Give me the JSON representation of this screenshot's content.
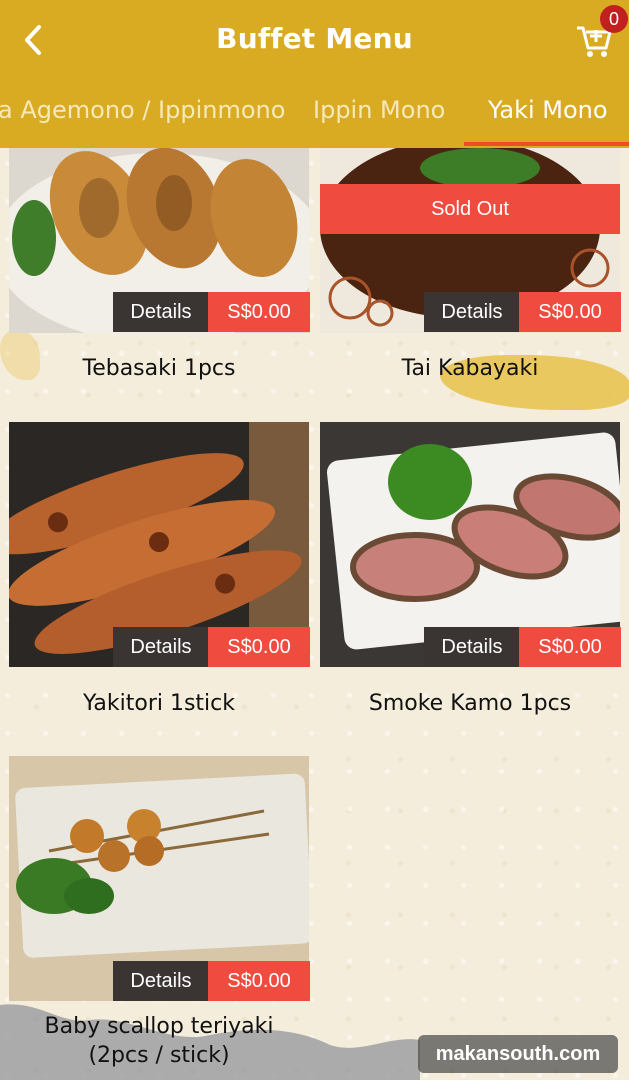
{
  "header": {
    "title": "Buffet Menu",
    "cart_count": "0"
  },
  "tabs": [
    {
      "label": "a Agemono / Ippinmono",
      "active": false
    },
    {
      "label": "Ippin Mono",
      "active": false
    },
    {
      "label": "Yaki Mono",
      "active": true
    }
  ],
  "items": [
    {
      "name": "Tebasaki 1pcs",
      "details": "Details",
      "price": "S$0.00",
      "sold_out": false
    },
    {
      "name": "Tai Kabayaki",
      "details": "Details",
      "price": "S$0.00",
      "sold_out": true,
      "sold_out_label": "Sold Out"
    },
    {
      "name": "Yakitori 1stick",
      "details": "Details",
      "price": "S$0.00",
      "sold_out": false
    },
    {
      "name": "Smoke Kamo 1pcs",
      "details": "Details",
      "price": "S$0.00",
      "sold_out": false
    },
    {
      "name": "Baby scallop teriyaki",
      "name_line2": "(2pcs / stick)",
      "details": "Details",
      "price": "S$0.00",
      "sold_out": false
    }
  ],
  "watermark": "makansouth.com",
  "colors": {
    "header": "#d9ab22",
    "accent": "#ef4b3f",
    "details": "#3a3533",
    "background": "#f4eddc"
  }
}
